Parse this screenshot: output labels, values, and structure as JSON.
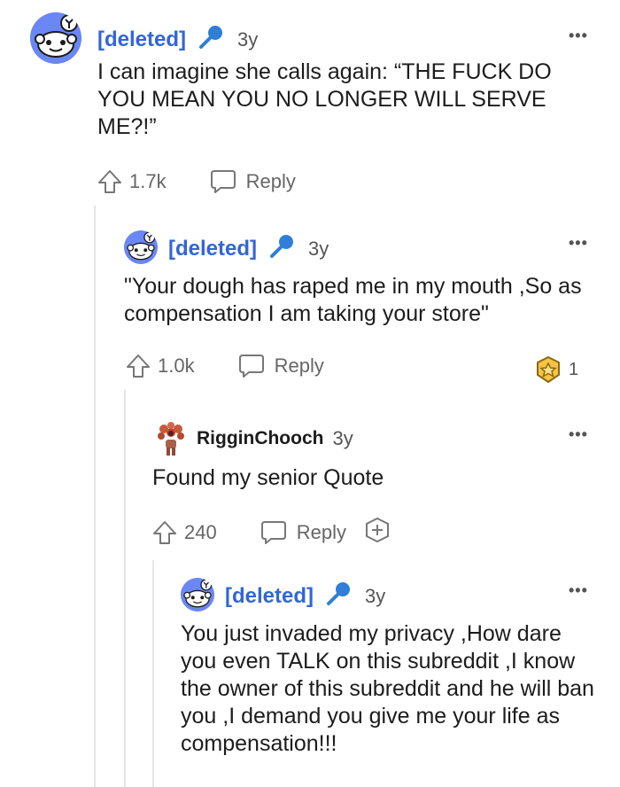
{
  "comments": [
    {
      "username": "[deleted]",
      "time": "3y",
      "body": "I can imagine she calls again: “THE FUCK DO YOU MEAN YOU NO LONGER WILL SERVE ME?!”",
      "upvotes": "1.7k",
      "reply_label": "Reply"
    },
    {
      "username": "[deleted]",
      "time": "3y",
      "body": "\"Your dough has raped me in my mouth ,So as compensation I am taking your store\"",
      "upvotes": "1.0k",
      "reply_label": "Reply",
      "award_count": "1"
    },
    {
      "username": "RigginChooch",
      "time": "3y",
      "body": "Found my senior Quote",
      "upvotes": "240",
      "reply_label": "Reply"
    },
    {
      "username": "[deleted]",
      "time": "3y",
      "body": "You just invaded my privacy ,How dare you even TALK on this subreddit ,I know the owner of this subreddit and he will ban you ,I demand you give me your life as compensation!!!"
    }
  ],
  "more_label": "•••",
  "colors": {
    "deleted_user": "#3266d6",
    "avatar_bg": "#6b87f5",
    "text": "#1c1c1c",
    "muted": "#666666",
    "thread_line": "#e5e5e5"
  },
  "icons": [
    "snoo-avatar-icon",
    "microphone-icon",
    "upvote-arrow-icon",
    "reply-bubble-icon",
    "award-badge-icon",
    "add-award-icon",
    "more-options-icon"
  ]
}
